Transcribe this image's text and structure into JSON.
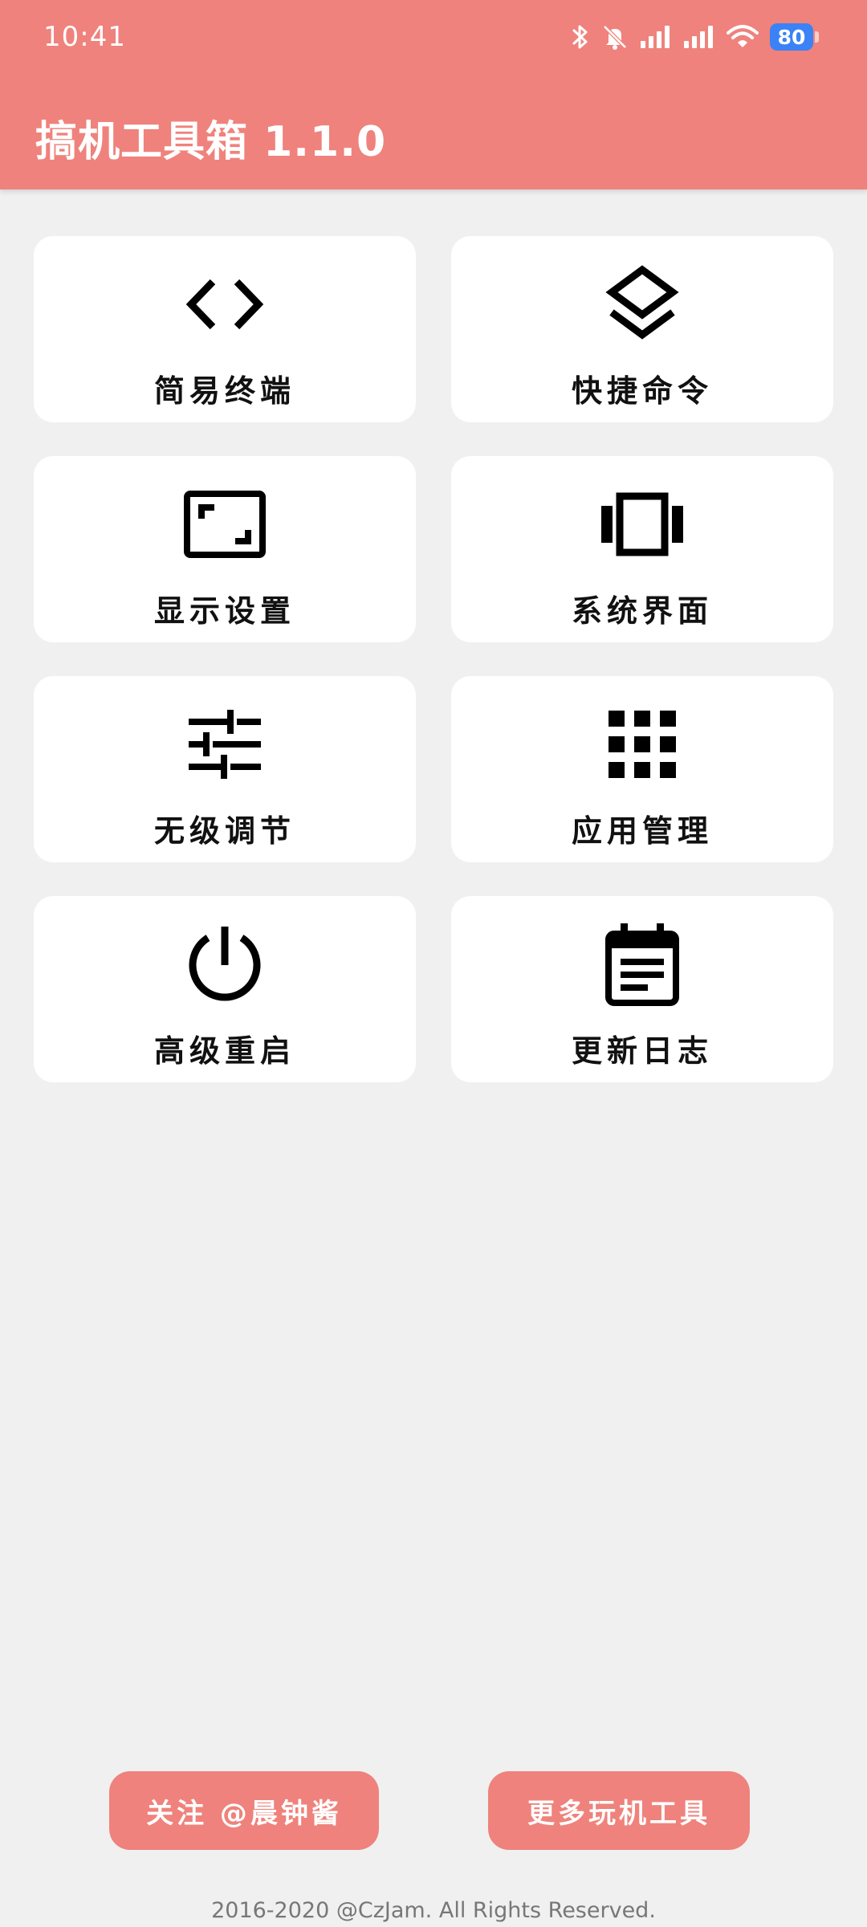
{
  "status_bar": {
    "time": "10:41",
    "battery_level": "80",
    "icons": [
      "bluetooth-icon",
      "mute-icon",
      "signal-icon",
      "signal-icon",
      "wifi-icon",
      "battery-icon"
    ]
  },
  "app_bar": {
    "title": "搞机工具箱 1.1.0",
    "background_color": "#ef827c"
  },
  "tools": [
    {
      "label": "简易终端",
      "icon": "code-icon"
    },
    {
      "label": "快捷命令",
      "icon": "layers-icon"
    },
    {
      "label": "显示设置",
      "icon": "aspect-ratio-icon"
    },
    {
      "label": "系统界面",
      "icon": "carousel-icon"
    },
    {
      "label": "无级调节",
      "icon": "tune-sliders-icon"
    },
    {
      "label": "应用管理",
      "icon": "apps-grid-icon"
    },
    {
      "label": "高级重启",
      "icon": "power-icon"
    },
    {
      "label": "更新日志",
      "icon": "calendar-notes-icon"
    }
  ],
  "actions": {
    "follow_label": "关注 @晨钟酱",
    "more_tools_label": "更多玩机工具"
  },
  "footer": {
    "copyright": "2016-2020 @CzJam. All Rights Reserved."
  }
}
